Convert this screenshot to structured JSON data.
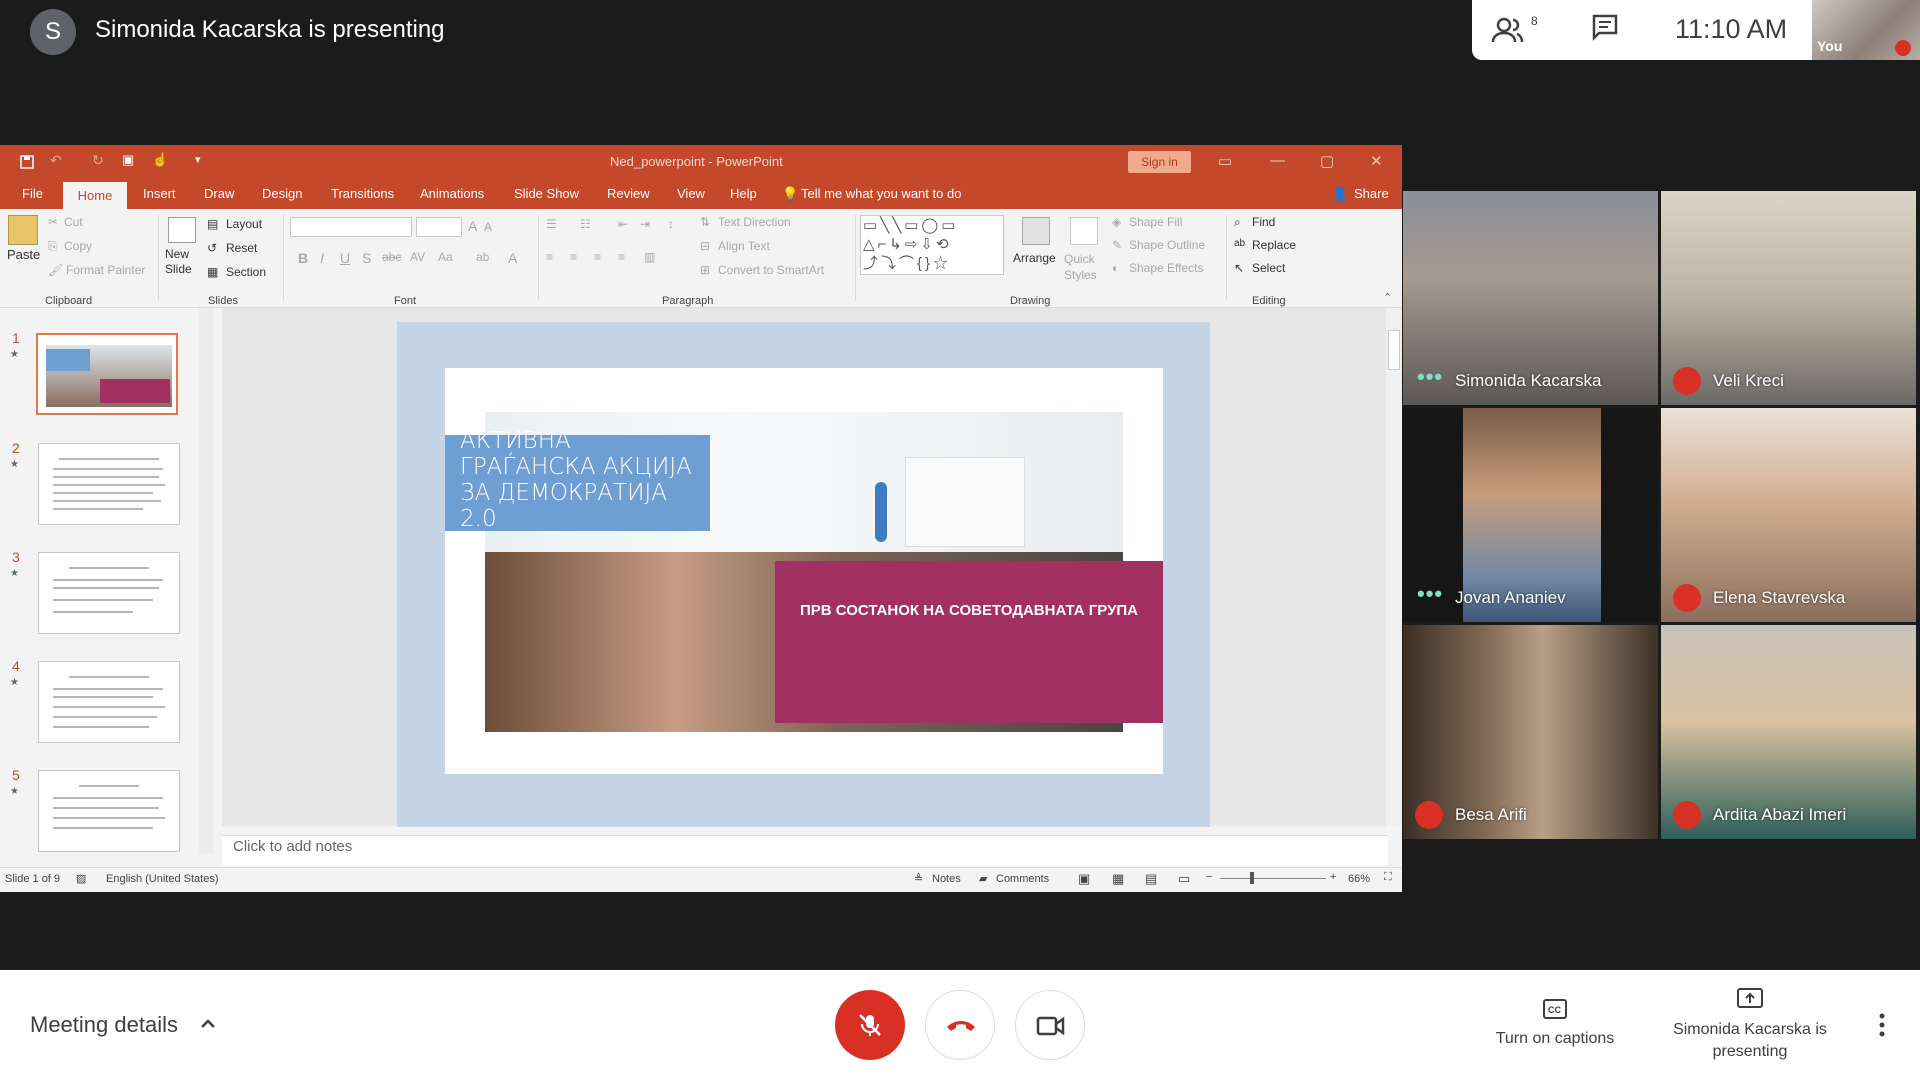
{
  "meet": {
    "presenter_initial": "S",
    "presenting_title": "Simonida Kacarska is presenting",
    "people_count": "8",
    "time": "11:10 AM",
    "self_label": "You"
  },
  "ppt": {
    "window_title": "Ned_powerpoint  -  PowerPoint",
    "sign_in": "Sign in",
    "tabs": [
      "File",
      "Home",
      "Insert",
      "Draw",
      "Design",
      "Transitions",
      "Animations",
      "Slide Show",
      "Review",
      "View",
      "Help"
    ],
    "tell_me": "Tell me what you want to do",
    "share": "Share",
    "ribbon": {
      "paste": "Paste",
      "cut": "Cut",
      "copy": "Copy",
      "format_painter": "Format Painter",
      "new_slide": "New Slide",
      "layout": "Layout",
      "reset": "Reset",
      "section": "Section",
      "text_direction": "Text Direction",
      "align_text": "Align Text",
      "convert_smartart": "Convert to SmartArt",
      "arrange": "Arrange",
      "quick_styles": "Quick Styles",
      "shape_fill": "Shape Fill",
      "shape_outline": "Shape Outline",
      "shape_effects": "Shape Effects",
      "find": "Find",
      "replace": "Replace",
      "select": "Select",
      "groups": [
        "Clipboard",
        "Slides",
        "Font",
        "Paragraph",
        "Drawing",
        "Editing"
      ]
    },
    "thumb_numbers": [
      "1",
      "2",
      "3",
      "4",
      "5"
    ],
    "slide": {
      "title": "АКТИВНА ГРАЃАНСКА АКЦИЈА ЗА ДЕМОКРАТИЈА 2.0",
      "subtitle": "ПРВ СОСТАНОК НА СОВЕТОДАВНАТА ГРУПА"
    },
    "notes_placeholder": "Click to add notes",
    "status": {
      "slide_of": "Slide 1 of 9",
      "language": "English (United States)",
      "notes": "Notes",
      "comments": "Comments",
      "zoom": "66%"
    },
    "colors": {
      "accent": "#c4482a",
      "title_box": "#6f9ed3",
      "magenta": "#a23060"
    }
  },
  "participants": [
    {
      "name": "Simonida Kacarska",
      "status": "speaking"
    },
    {
      "name": "Veli Kreci",
      "status": "muted"
    },
    {
      "name": "Jovan Ananiev",
      "status": "speaking"
    },
    {
      "name": "Elena Stavrevska",
      "status": "muted"
    },
    {
      "name": "Besa Arifi",
      "status": "muted"
    },
    {
      "name": "Ardita Abazi Imeri",
      "status": "muted"
    }
  ],
  "bottom": {
    "meeting_details": "Meeting details",
    "captions": "Turn on captions",
    "presenting": "Simonida Kacarska is presenting"
  }
}
